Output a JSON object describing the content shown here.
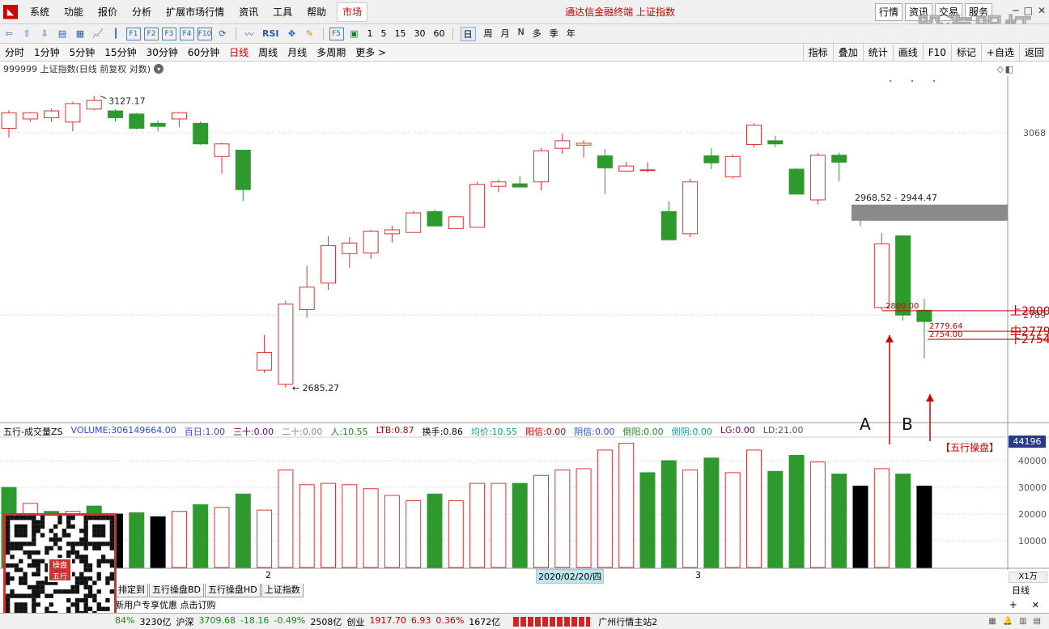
{
  "menu": {
    "items": [
      "系统",
      "功能",
      "报价",
      "分析",
      "扩展市场行情",
      "资讯",
      "工具",
      "帮助"
    ],
    "active": "市场",
    "title": "通达信金融终端 上证指数",
    "right_buttons": [
      "行情",
      "资讯",
      "交易",
      "服务"
    ],
    "watermark": "股海明灯"
  },
  "toolbar": {
    "text_buttons": [
      "RSI",
      "F5"
    ],
    "numbers": [
      "1",
      "5",
      "15",
      "30",
      "60"
    ],
    "periods": [
      "日",
      "周",
      "月",
      "N",
      "多",
      "季",
      "年"
    ]
  },
  "periodbar": {
    "items": [
      "分时",
      "1分钟",
      "5分钟",
      "15分钟",
      "30分钟",
      "60分钟",
      "日线",
      "周线",
      "月线",
      "多周期",
      "更多 >"
    ],
    "active": "日线",
    "right": [
      "指标",
      "叠加",
      "统计",
      "画线",
      "F10",
      "标记",
      "+自选",
      "返回"
    ]
  },
  "chart_title": "999999 上证指数(日线 前复权 对数)",
  "chart_data": {
    "type": "candlestick",
    "candles": [
      {
        "o": 3075,
        "c": 3100,
        "h": 3104,
        "l": 3060
      },
      {
        "o": 3090,
        "c": 3100,
        "h": 3101,
        "l": 3085
      },
      {
        "o": 3092,
        "c": 3103,
        "h": 3107,
        "l": 3085
      },
      {
        "o": 3085,
        "c": 3115,
        "h": 3118,
        "l": 3070
      },
      {
        "o": 3106,
        "c": 3120,
        "h": 3127.17,
        "l": 3104
      },
      {
        "o": 3103,
        "c": 3092,
        "h": 3106,
        "l": 3086
      },
      {
        "o": 3098,
        "c": 3075,
        "h": 3100,
        "l": 3073
      },
      {
        "o": 3083,
        "c": 3078,
        "h": 3088,
        "l": 3070
      },
      {
        "o": 3090,
        "c": 3100,
        "h": 3101,
        "l": 3077
      },
      {
        "o": 3083,
        "c": 3050,
        "h": 3086,
        "l": 3048
      },
      {
        "o": 3030,
        "c": 3050,
        "h": 3052,
        "l": 3003
      },
      {
        "o": 3040,
        "c": 2978,
        "h": 3041,
        "l": 2960
      },
      {
        "o": 2710,
        "c": 2735,
        "h": 2760,
        "l": 2706
      },
      {
        "o": 2690,
        "c": 2805,
        "h": 2810,
        "l": 2685.27
      },
      {
        "o": 2797,
        "c": 2830,
        "h": 2862,
        "l": 2785
      },
      {
        "o": 2836,
        "c": 2892,
        "h": 2906,
        "l": 2826
      },
      {
        "o": 2880,
        "c": 2896,
        "h": 2905,
        "l": 2859
      },
      {
        "o": 2881,
        "c": 2914,
        "h": 2916,
        "l": 2872
      },
      {
        "o": 2910,
        "c": 2916,
        "h": 2922,
        "l": 2897
      },
      {
        "o": 2912,
        "c": 2942,
        "h": 2945,
        "l": 2912
      },
      {
        "o": 2944,
        "c": 2922,
        "h": 2947,
        "l": 2921
      },
      {
        "o": 2918,
        "c": 2936,
        "h": 2937,
        "l": 2917
      },
      {
        "o": 2920,
        "c": 2986,
        "h": 2990,
        "l": 2920
      },
      {
        "o": 2983,
        "c": 2990,
        "h": 2994,
        "l": 2974
      },
      {
        "o": 2987,
        "c": 2982,
        "h": 2999,
        "l": 2982
      },
      {
        "o": 2990,
        "c": 3039,
        "h": 3043,
        "l": 2977
      },
      {
        "o": 3043,
        "c": 3055,
        "h": 3067,
        "l": 3034
      },
      {
        "o": 3048,
        "c": 3051,
        "h": 3056,
        "l": 3028
      },
      {
        "o": 3031,
        "c": 3012,
        "h": 3042,
        "l": 2971
      },
      {
        "o": 3007,
        "c": 3015,
        "h": 3022,
        "l": 3006
      },
      {
        "o": 3008,
        "c": 3009,
        "h": 3021,
        "l": 3005
      },
      {
        "o": 2944,
        "c": 2901,
        "h": 2960,
        "l": 2900
      },
      {
        "o": 2910,
        "c": 2990,
        "h": 2995,
        "l": 2905
      },
      {
        "o": 3031,
        "c": 3020,
        "h": 3043,
        "l": 3010
      },
      {
        "o": 2998,
        "c": 3030,
        "h": 3033,
        "l": 2995
      },
      {
        "o": 3049,
        "c": 3080,
        "h": 3083,
        "l": 3044
      },
      {
        "o": 3055,
        "c": 3050,
        "h": 3063,
        "l": 3045
      },
      {
        "o": 3010,
        "c": 2971,
        "h": 3011,
        "l": 2970
      },
      {
        "o": 2962,
        "c": 3032,
        "h": 3035,
        "l": 2955
      },
      {
        "o": 3032,
        "c": 3021,
        "h": 3036,
        "l": 2991
      },
      {
        "o": 2950,
        "c": 2940,
        "h": 2952,
        "l": 2922
      },
      {
        "o": 2800,
        "c": 2895,
        "h": 2911,
        "l": 2796
      },
      {
        "o": 2907,
        "c": 2789,
        "h": 2908,
        "l": 2781
      },
      {
        "o": 2796,
        "c": 2779.64,
        "h": 2813,
        "l": 2727
      }
    ],
    "ylim": [
      2640,
      3160
    ],
    "ticks": [
      3068,
      2789
    ],
    "annotations": {
      "high_label": "3127.17",
      "low_label": "2685.27",
      "range_label": "2968.52 - 2944.47",
      "label_2800": "2800.00",
      "label_2779": "2779.64",
      "label_2754": "2754.00",
      "upper": "上2800",
      "middle": "中2779",
      "lower": "下2754",
      "A": "A",
      "B": "B",
      "brand": "【五行操盘】"
    },
    "date_marks": [
      "2",
      "2020/02/20/四",
      "3"
    ]
  },
  "vol_header": {
    "name": "五行-成交量ZS",
    "fields": [
      {
        "k": "VOLUME:",
        "v": "306149664.00",
        "color": "#2a4bd7"
      },
      {
        "k": "百日:",
        "v": "1.00",
        "color": "#2a4bd7"
      },
      {
        "k": "三十:",
        "v": "0.00",
        "color": "#800080"
      },
      {
        "k": "二十:",
        "v": "0.00",
        "color": "#888888"
      },
      {
        "k": "人:",
        "v": "10.55",
        "color": "#1a8a1a"
      },
      {
        "k": "LTB:",
        "v": "0.87",
        "color": "#c00000"
      },
      {
        "k": "换手:",
        "v": "0.86",
        "color": "#000000"
      },
      {
        "k": "均价:",
        "v": "10.55",
        "color": "#00a0a0"
      },
      {
        "k": "阳信:",
        "v": "0.00",
        "color": "#c00000"
      },
      {
        "k": "阴信:",
        "v": "0.00",
        "color": "#2a4bd7"
      },
      {
        "k": "倒阳:",
        "v": "0.00",
        "color": "#1a8a1a"
      },
      {
        "k": "倒阴:",
        "v": "0.00",
        "color": "#00a0a0"
      },
      {
        "k": "LG:",
        "v": "0.00",
        "color": "#800080"
      },
      {
        "k": "LD:",
        "v": "21.00",
        "color": "#555555"
      }
    ],
    "right_value": "44196"
  },
  "volume": {
    "values": [
      30000,
      24000,
      21000,
      21000,
      23000,
      20000,
      20500,
      19000,
      21000,
      23500,
      22500,
      27500,
      21500,
      36500,
      31000,
      31500,
      31000,
      29500,
      27000,
      25000,
      27500,
      25000,
      31500,
      31500,
      31500,
      34500,
      36500,
      37000,
      44000,
      46500,
      35500,
      40000,
      36500,
      41000,
      35500,
      44000,
      36000,
      42000,
      39500,
      35000,
      30500,
      37000,
      35000,
      30500
    ],
    "colors": [
      "g",
      "r",
      "g",
      "r",
      "g",
      "k",
      "g",
      "k",
      "r",
      "g",
      "r",
      "g",
      "r",
      "r",
      "r",
      "r",
      "r",
      "r",
      "r",
      "r",
      "g",
      "r",
      "r",
      "r",
      "g",
      "r",
      "r",
      "r",
      "r",
      "r",
      "g",
      "g",
      "r",
      "g",
      "r",
      "r",
      "g",
      "g",
      "r",
      "g",
      "k",
      "r",
      "g",
      "k"
    ],
    "ylim": [
      0,
      47000
    ],
    "ticks": [
      "40000",
      "30000",
      "20000",
      "10000"
    ],
    "unit": "X1万"
  },
  "tabs": [
    "排定到",
    "五行操盘BD",
    "五行操盘HD",
    "上证指数"
  ],
  "period_label": "日线",
  "links": [
    "新用户专享优惠 点击订购"
  ],
  "logo_text": "操盘五行",
  "status": {
    "items": [
      {
        "text": "84%",
        "color": "#1a8a1a"
      },
      {
        "text": "3230亿",
        "color": "#000"
      },
      {
        "text": "沪深",
        "color": "#000"
      },
      {
        "text": "3709.68",
        "color": "#1a8a1a"
      },
      {
        "text": "-18.16",
        "color": "#1a8a1a"
      },
      {
        "text": "-0.49%",
        "color": "#1a8a1a"
      },
      {
        "text": "2508亿",
        "color": "#000"
      },
      {
        "text": "创业",
        "color": "#000"
      },
      {
        "text": "1917.70",
        "color": "#c00000"
      },
      {
        "text": "6.93",
        "color": "#c00000"
      },
      {
        "text": "0.36%",
        "color": "#c00000"
      },
      {
        "text": "1672亿",
        "color": "#000"
      }
    ],
    "server": "广州行情主站2"
  }
}
